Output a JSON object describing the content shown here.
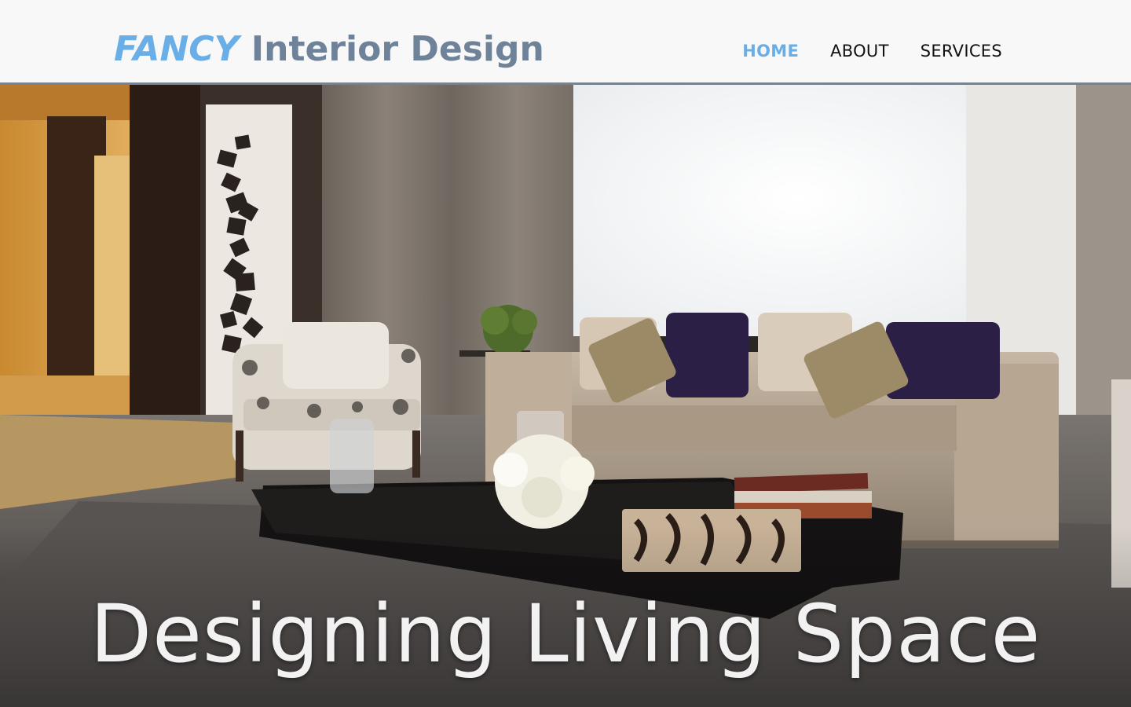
{
  "header": {
    "logo_emphasis": "FANCY",
    "logo_rest": "Interior Design"
  },
  "nav": {
    "items": [
      "HOME",
      "ABOUT",
      "SERVICES"
    ],
    "active": "HOME"
  },
  "hero": {
    "tagline": "Designing Living Space",
    "image": "living-room-photo"
  },
  "colors": {
    "accent": "#6aaee8",
    "logo_gray": "#6e8299",
    "header_bg": "#f8f8f8",
    "header_border": "#6f8399"
  }
}
